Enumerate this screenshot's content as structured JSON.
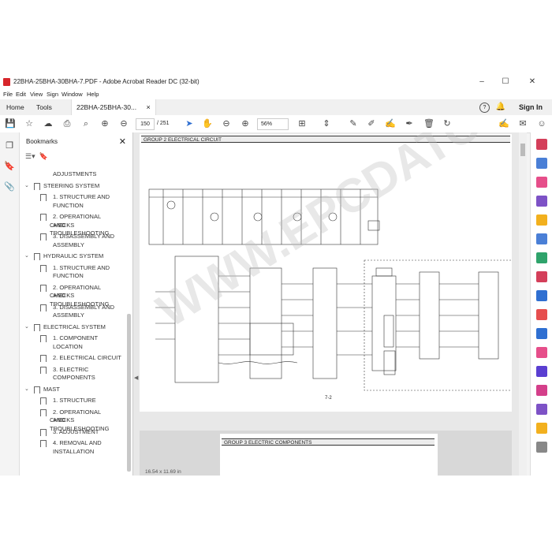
{
  "window": {
    "title": "22BHA-25BHA-30BHA-7.PDF - Adobe Acrobat Reader DC (32-bit)",
    "minimize": "–",
    "maximize": "☐",
    "close": "✕"
  },
  "menu": [
    "File",
    "Edit",
    "View",
    "Sign",
    "Window",
    "Help"
  ],
  "tabs": {
    "home": "Home",
    "tools": "Tools",
    "doc": "22BHA-25BHA-30...",
    "doc_close": "×",
    "signin": "Sign In"
  },
  "toolbar": {
    "page_current": "150",
    "page_total": "/ 251",
    "zoom": "56%"
  },
  "bookmarks": {
    "header": "Bookmarks",
    "close": "✕",
    "items": [
      {
        "label": "ADJUSTMENTS",
        "level": 1
      },
      {
        "label": "STEERING SYSTEM",
        "level": 0
      },
      {
        "label": "1. STRUCTURE AND",
        "level": 1
      },
      {
        "label": "FUNCTION",
        "level": 1
      },
      {
        "label": "2. OPERATIONAL CHECKS",
        "level": 1
      },
      {
        "label": "AND TROUBLESHOOTING",
        "level": 1
      },
      {
        "label": "3. DISASSEMBLY AND",
        "level": 1
      },
      {
        "label": "ASSEMBLY",
        "level": 1
      },
      {
        "label": "HYDRAULIC SYSTEM",
        "level": 0
      },
      {
        "label": "1. STRUCTURE AND",
        "level": 1
      },
      {
        "label": "FUNCTION",
        "level": 1
      },
      {
        "label": "2. OPERATIONAL CHECKS",
        "level": 1
      },
      {
        "label": "AND TROUBLESHOOTING",
        "level": 1
      },
      {
        "label": "3. DISASSEMBLY AND",
        "level": 1
      },
      {
        "label": "ASSEMBLY",
        "level": 1
      },
      {
        "label": "ELECTRICAL SYSTEM",
        "level": 0
      },
      {
        "label": "1. COMPONENT",
        "level": 1
      },
      {
        "label": "LOCATION",
        "level": 1
      },
      {
        "label": "2. ELECTRICAL CIRCUIT",
        "level": 1
      },
      {
        "label": "3. ELECTRIC",
        "level": 1
      },
      {
        "label": "COMPONENTS",
        "level": 1
      },
      {
        "label": "MAST",
        "level": 0
      },
      {
        "label": "1. STRUCTURE",
        "level": 1
      },
      {
        "label": "2. OPERATIONAL CHECKS",
        "level": 1
      },
      {
        "label": "AND TROUBLESHOOTING",
        "level": 1
      },
      {
        "label": "3. ADJUSTMENT",
        "level": 1
      },
      {
        "label": "4. REMOVAL AND",
        "level": 1
      },
      {
        "label": "INSTALLATION",
        "level": 1
      }
    ]
  },
  "document": {
    "page1_heading": "GROUP  2  ELECTRICAL CIRCUIT",
    "page1_number": "7-2",
    "page2_heading": "GROUP  3  ELECTRIC COMPONENTS",
    "watermark": "WWW.EPCDATO.COM"
  },
  "status": {
    "page_size": "16.54 x 11.69 in"
  },
  "colors": {
    "accent": "#d7262b",
    "rail_icons": [
      "#d43f5a",
      "#4a7fd6",
      "#e64e8a",
      "#7d52c6",
      "#f2b01e",
      "#4a7fd6",
      "#2fa36b",
      "#d43f5a",
      "#2f6fd1",
      "#e64e4e",
      "#2f6fd1",
      "#e64e8a",
      "#5a3fd1",
      "#d43f8a",
      "#7d52c6",
      "#f2b01e",
      "#888888"
    ]
  }
}
